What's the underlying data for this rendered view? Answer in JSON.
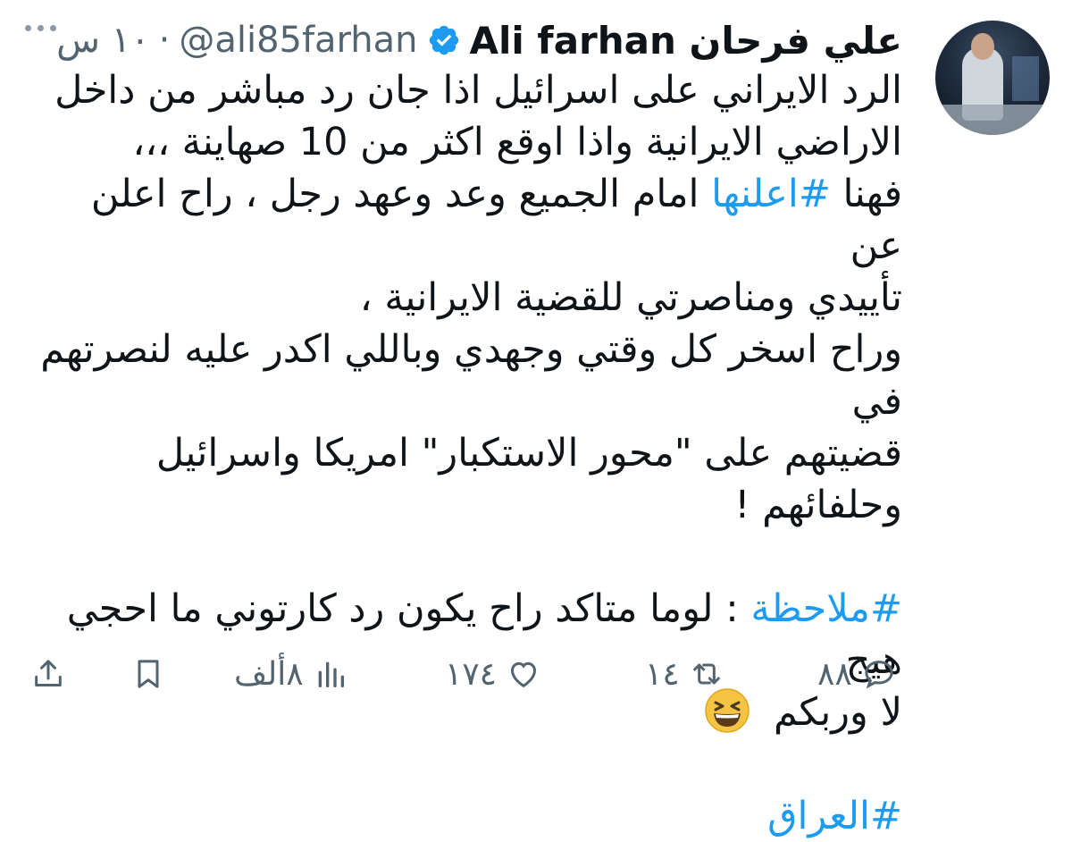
{
  "tweet": {
    "name": "Ali farhan علي فرحان",
    "handle": "@ali85farhan",
    "separator": "·",
    "time": "١٠ س",
    "paragraph1_lines": [
      "الرد الايراني على اسرائيل اذا جان رد مباشر من داخل",
      "الاراضي الايرانية واذا اوقع اكثر من 10 صهاينة ،،،"
    ],
    "line3_prefix": "فهنا",
    "line3_hashtag": "#اعلنها",
    "line3_suffix": "امام الجميع وعد وعهد رجل ، راح اعلن عن",
    "paragraph2_lines": [
      "تأييدي ومناصرتي للقضية الايرانية ،",
      "وراح اسخر كل وقتي وجهدي وباللي اكدر عليه لنصرتهم في",
      "قضيتهم على \"محور الاستكبار\" امريكا واسرائيل وحلفائهم !"
    ],
    "note_hashtag": "#ملاحظة",
    "note_text": ":  لوما متاكد راح يكون رد كارتوني ما احجي هيج",
    "note_line2": "لا وربكم",
    "final_hashtag": "#العراق",
    "emoji": "grinning-squinting-face"
  },
  "actions": {
    "reply_count": "٨٨",
    "retweet_count": "١٤",
    "like_count": "١٧٤",
    "views_count": "٨ألف"
  },
  "colors": {
    "text": "#0f1419",
    "secondary": "#536471",
    "accent": "#1d9bf0"
  }
}
